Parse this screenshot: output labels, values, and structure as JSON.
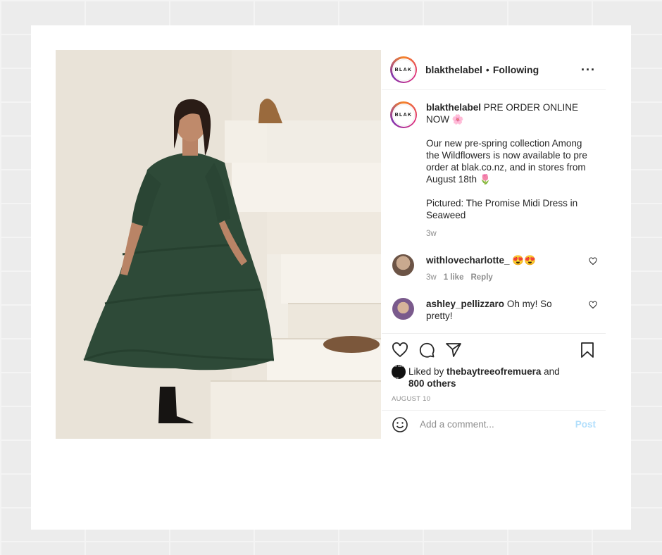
{
  "post": {
    "username": "blakthelabel",
    "avatar_text": "BLAK",
    "separator": "•",
    "follow_status": "Following",
    "more_icon": "more-horizontal-icon"
  },
  "caption": {
    "username": "blakthelabel",
    "line1": " PRE ORDER ONLINE NOW 🌸",
    "paragraph2": "Our new pre-spring collection Among the Wildflowers is now available to pre order at blak.co.nz, and in stores from August 18th 🌷",
    "paragraph3": "Pictured: The Promise Midi Dress in Seaweed",
    "time": "3w"
  },
  "comments": [
    {
      "username": "withlovecharlotte_",
      "text": " 😍😍",
      "time": "3w",
      "likes": "1 like",
      "reply": "Reply"
    },
    {
      "username": "ashley_pellizzaro",
      "text": " Oh my! So pretty!"
    }
  ],
  "likes": {
    "prefix": "Liked by ",
    "username": "thebaytreeofremuera",
    "and": " and",
    "others": "800 others",
    "avatar_text": "THE BAY TREE"
  },
  "date": "August 10",
  "add_comment": {
    "placeholder": "Add a comment...",
    "post_label": "Post"
  },
  "colors": {
    "accent_link": "#b2dffc",
    "muted": "#8e8e8e",
    "dress": "#2e4a38"
  }
}
